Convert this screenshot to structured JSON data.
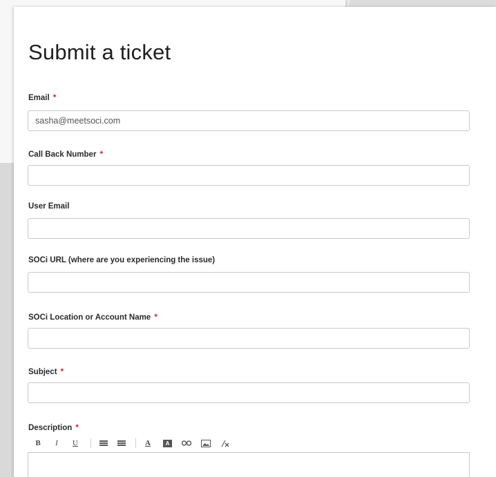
{
  "form": {
    "title": "Submit a ticket",
    "fields": {
      "email": {
        "label": "Email",
        "required_mark": "*",
        "value": "sasha@meetsoci.com"
      },
      "call_back_number": {
        "label": "Call Back Number",
        "required_mark": "*",
        "value": ""
      },
      "user_email": {
        "label": "User Email",
        "value": ""
      },
      "soci_url": {
        "label": "SOCi URL (where are you experiencing the issue)",
        "value": ""
      },
      "soci_location": {
        "label": "SOCi Location or Account Name",
        "required_mark": "*",
        "value": ""
      },
      "subject": {
        "label": "Subject",
        "required_mark": "*",
        "value": ""
      },
      "description": {
        "label": "Description",
        "required_mark": "*",
        "value": ""
      }
    },
    "toolbar": {
      "bold": "B",
      "italic": "I",
      "underline": "U",
      "font_color": "A",
      "background_color": "A",
      "buttons": [
        "bold-icon",
        "italic-icon",
        "underline-icon",
        "bulleted-list-icon",
        "numbered-list-icon",
        "font-color-icon",
        "background-color-icon",
        "link-icon",
        "image-icon",
        "clear-formatting-icon"
      ]
    }
  },
  "colors": {
    "required": "#d9252b",
    "border": "#c9c9c9",
    "background": "#e6e6e6"
  }
}
